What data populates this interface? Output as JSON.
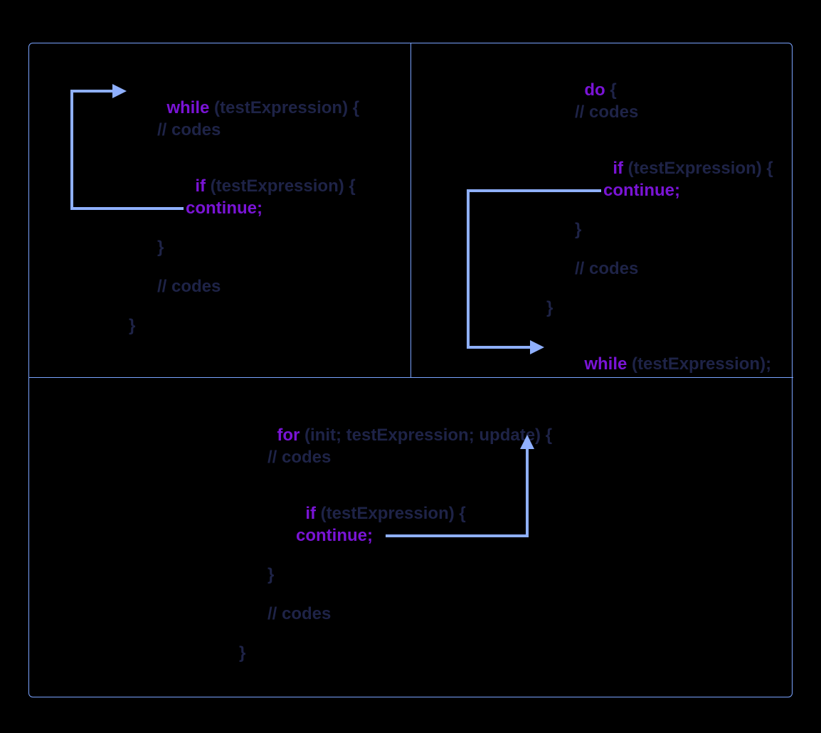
{
  "colors": {
    "keyword": "#7a14d6",
    "text": "#1e2347",
    "arrow": "#8fb0ff",
    "border": "#7aa3ff",
    "background": "#000000"
  },
  "while_block": {
    "l1_kw": "while",
    "l1_rest": " (testExpression) {",
    "l2": "// codes",
    "l3_kw": "if",
    "l3_rest": " (testExpression) {",
    "l4": "continue;",
    "l5": "}",
    "l6": "// codes",
    "l7": "}"
  },
  "do_block": {
    "l1_kw": "do",
    "l1_rest": " {",
    "l2": "// codes",
    "l3_kw": "if",
    "l3_rest": " (testExpression) {",
    "l4": "continue;",
    "l5": "}",
    "l6": "// codes",
    "l7": "}",
    "l8_kw": "while",
    "l8_rest": " (testExpression);"
  },
  "for_block": {
    "l1_kw": "for",
    "l1_rest": " (init; testExpression; update) {",
    "l2": "// codes",
    "l3_kw": "if",
    "l3_rest": " (testExpression) {",
    "l4": "continue;",
    "l5": "}",
    "l6": "// codes",
    "l7": "}"
  }
}
